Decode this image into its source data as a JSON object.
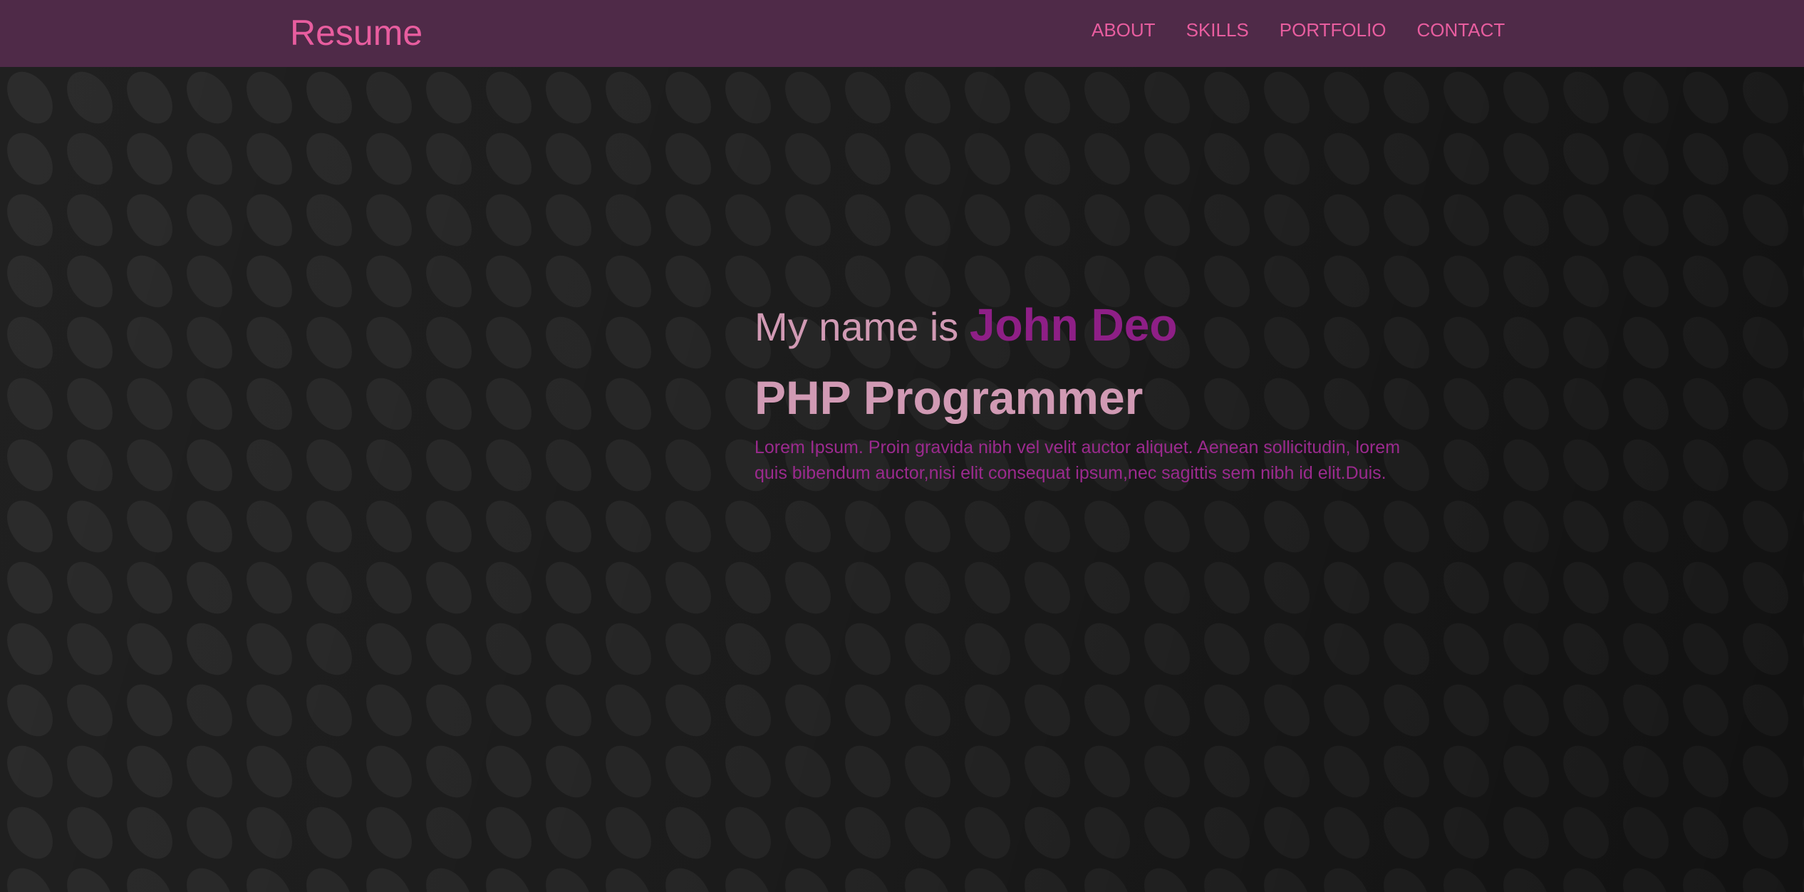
{
  "nav": {
    "brand": "Resume",
    "links": [
      "ABOUT",
      "SKILLS",
      "PORTFOLIO",
      "CONTACT"
    ]
  },
  "hero": {
    "greeting": "My name is",
    "name": "John Deo",
    "role": "PHP Programmer",
    "description": "Lorem Ipsum. Proin gravida nibh vel velit auctor aliquet. Aenean sollicitudin, lorem quis bibendum auctor,nisi elit consequat ipsum,nec sagittis sem nibh id elit.Duis."
  },
  "colors": {
    "navbar_bg": "#4f2a48",
    "accent_pink": "#e85d9f",
    "light_pink": "#d19ab4",
    "purple": "#8e1f86"
  }
}
